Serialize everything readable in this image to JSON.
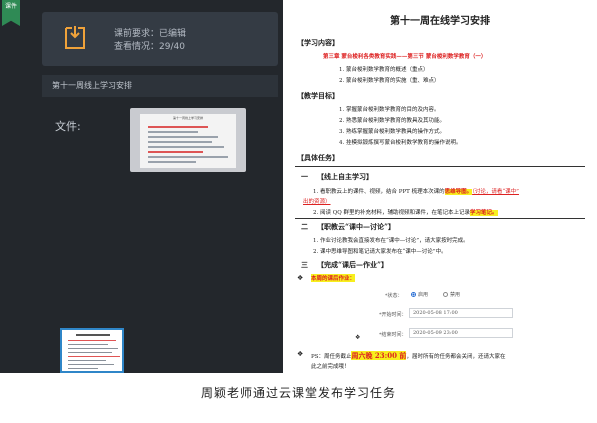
{
  "app": {
    "badge": "课件",
    "card": {
      "requirement": "课前要求：已编辑",
      "views": "查看情况：29/40"
    },
    "section_title": "第十一周线上学习安排",
    "file_label": "文件:",
    "thumbnail_title": "第十一周线上学习安排"
  },
  "doc": {
    "title": "第十一周在线学习安排",
    "content_heading": "【学习内容】",
    "content_chapter": "第三章   蒙台梭利各类教育实践——第三节   蒙台梭利数学教育（一）",
    "content_items": [
      "1. 蒙台梭利数学教育的概述（重点）",
      "2. 蒙台梭利数学教育的实施（重、难点）"
    ],
    "goals_heading": "【教学目标】",
    "goals": [
      "1. 掌握蒙台梭利数学教育的目的及内容。",
      "2. 熟悉蒙台梭利数学教育的教具及其功能。",
      "3. 熟练掌握蒙台梭利数学教具的操作方式。",
      "4. 挂模拟锻炼撰写蒙台梭利数学教育的操作说明。"
    ],
    "tasks_heading": "【具体任务】",
    "task1_no": "一",
    "task1_title": "【线上自主学习】",
    "task1_item1_a": "1. 看职教云上的课件、视频，结合 PPT 梳理本次课的",
    "task1_item1_mark": "思维导图。",
    "task1_item1_link": "（讨论，请看“课中”",
    "task1_item1_link2": "出的资源）",
    "task1_item2_a": "2. 阅读 QQ 群里的补充材料，辅助视频和课件，在笔记本上记录",
    "task1_item2_mark": "学习笔记。",
    "task2_no": "二",
    "task2_title": "【职教云“课中—讨论”】",
    "task2_items": [
      "1. 作业讨论教我会直接发布在“课中—讨论”，请大家按时完成。",
      "2. 课中思维导图和笔记请大家发布在“课中—讨论”中。"
    ],
    "task3_no": "三",
    "task3_title": "【完成“课后—作业”】",
    "bullet": "❖",
    "homework_label": "本周的课后作业：",
    "form": {
      "status_label": "*状态：",
      "enabled": "启用",
      "disabled": "禁用",
      "start_label": "*开始时间：",
      "start_value": "2020-05-08 17:00",
      "end_label": "*结束时间：",
      "end_value": "2020-05-09 23:00"
    },
    "ps_a": "PS：周任务截止",
    "ps_mark": "周六晚 23:00 前",
    "ps_b": "，届时所有的任务都会关闭，还请大家在",
    "ps_c": "此之前完成哦！"
  },
  "caption": "周颖老师通过云课堂发布学习任务",
  "colors": {
    "panel_bg": "#23272c",
    "card_bg": "#343b44",
    "accent_orange": "#f0a23a",
    "badge_green": "#2f8a55",
    "highlight_red": "#d22222",
    "highlight_yellow": "#f7ef1e"
  }
}
